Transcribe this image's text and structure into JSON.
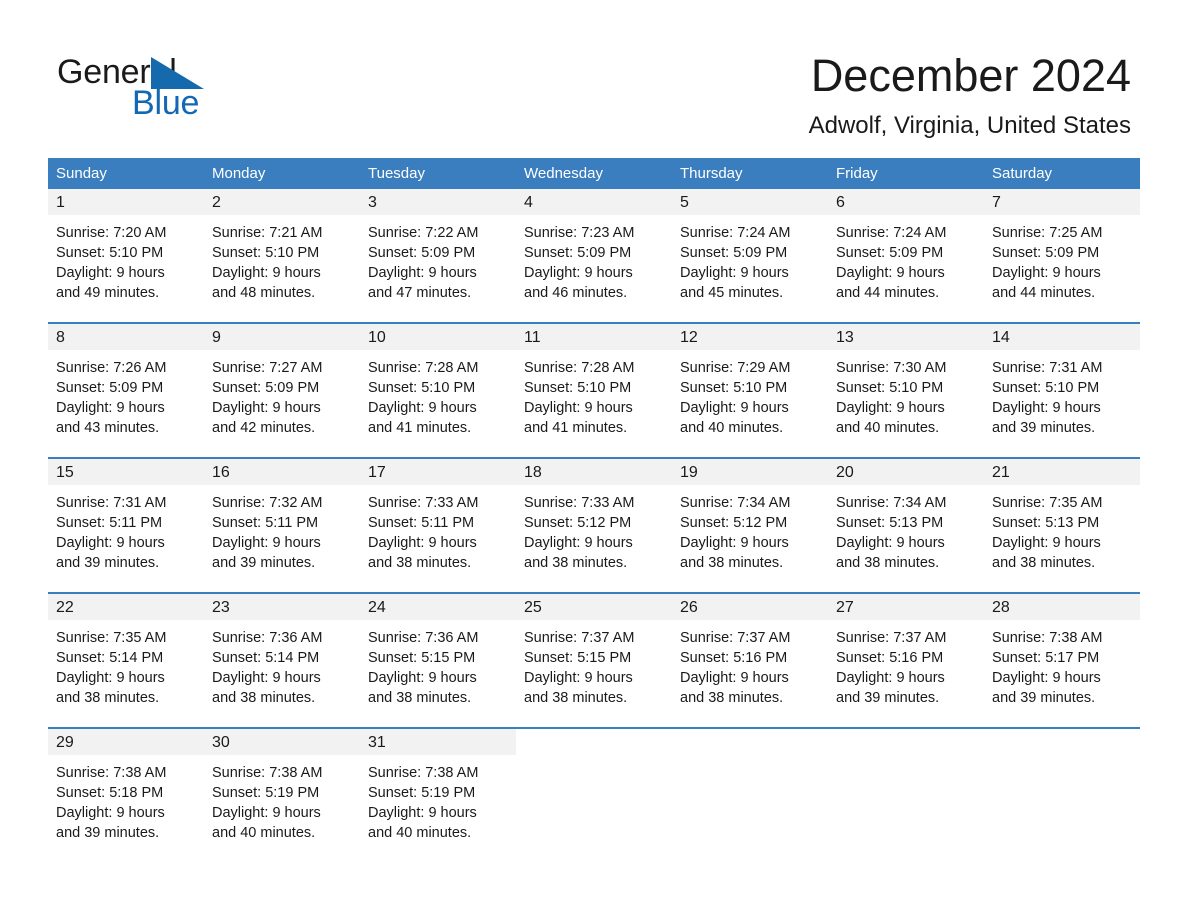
{
  "brand": {
    "name_part1": "General",
    "name_part2": "Blue",
    "accent_color": "#1268b3",
    "triangle_color": "#156aae"
  },
  "header": {
    "month_title": "December 2024",
    "location": "Adwolf, Virginia, United States"
  },
  "theme": {
    "header_row_color": "#3a7ebf",
    "daynum_band_color": "#f2f2f2",
    "text_color": "#1a1a1a"
  },
  "weekdays": [
    "Sunday",
    "Monday",
    "Tuesday",
    "Wednesday",
    "Thursday",
    "Friday",
    "Saturday"
  ],
  "weeks": [
    [
      {
        "day": "1",
        "sunrise": "Sunrise: 7:20 AM",
        "sunset": "Sunset: 5:10 PM",
        "daylight1": "Daylight: 9 hours",
        "daylight2": "and 49 minutes."
      },
      {
        "day": "2",
        "sunrise": "Sunrise: 7:21 AM",
        "sunset": "Sunset: 5:10 PM",
        "daylight1": "Daylight: 9 hours",
        "daylight2": "and 48 minutes."
      },
      {
        "day": "3",
        "sunrise": "Sunrise: 7:22 AM",
        "sunset": "Sunset: 5:09 PM",
        "daylight1": "Daylight: 9 hours",
        "daylight2": "and 47 minutes."
      },
      {
        "day": "4",
        "sunrise": "Sunrise: 7:23 AM",
        "sunset": "Sunset: 5:09 PM",
        "daylight1": "Daylight: 9 hours",
        "daylight2": "and 46 minutes."
      },
      {
        "day": "5",
        "sunrise": "Sunrise: 7:24 AM",
        "sunset": "Sunset: 5:09 PM",
        "daylight1": "Daylight: 9 hours",
        "daylight2": "and 45 minutes."
      },
      {
        "day": "6",
        "sunrise": "Sunrise: 7:24 AM",
        "sunset": "Sunset: 5:09 PM",
        "daylight1": "Daylight: 9 hours",
        "daylight2": "and 44 minutes."
      },
      {
        "day": "7",
        "sunrise": "Sunrise: 7:25 AM",
        "sunset": "Sunset: 5:09 PM",
        "daylight1": "Daylight: 9 hours",
        "daylight2": "and 44 minutes."
      }
    ],
    [
      {
        "day": "8",
        "sunrise": "Sunrise: 7:26 AM",
        "sunset": "Sunset: 5:09 PM",
        "daylight1": "Daylight: 9 hours",
        "daylight2": "and 43 minutes."
      },
      {
        "day": "9",
        "sunrise": "Sunrise: 7:27 AM",
        "sunset": "Sunset: 5:09 PM",
        "daylight1": "Daylight: 9 hours",
        "daylight2": "and 42 minutes."
      },
      {
        "day": "10",
        "sunrise": "Sunrise: 7:28 AM",
        "sunset": "Sunset: 5:10 PM",
        "daylight1": "Daylight: 9 hours",
        "daylight2": "and 41 minutes."
      },
      {
        "day": "11",
        "sunrise": "Sunrise: 7:28 AM",
        "sunset": "Sunset: 5:10 PM",
        "daylight1": "Daylight: 9 hours",
        "daylight2": "and 41 minutes."
      },
      {
        "day": "12",
        "sunrise": "Sunrise: 7:29 AM",
        "sunset": "Sunset: 5:10 PM",
        "daylight1": "Daylight: 9 hours",
        "daylight2": "and 40 minutes."
      },
      {
        "day": "13",
        "sunrise": "Sunrise: 7:30 AM",
        "sunset": "Sunset: 5:10 PM",
        "daylight1": "Daylight: 9 hours",
        "daylight2": "and 40 minutes."
      },
      {
        "day": "14",
        "sunrise": "Sunrise: 7:31 AM",
        "sunset": "Sunset: 5:10 PM",
        "daylight1": "Daylight: 9 hours",
        "daylight2": "and 39 minutes."
      }
    ],
    [
      {
        "day": "15",
        "sunrise": "Sunrise: 7:31 AM",
        "sunset": "Sunset: 5:11 PM",
        "daylight1": "Daylight: 9 hours",
        "daylight2": "and 39 minutes."
      },
      {
        "day": "16",
        "sunrise": "Sunrise: 7:32 AM",
        "sunset": "Sunset: 5:11 PM",
        "daylight1": "Daylight: 9 hours",
        "daylight2": "and 39 minutes."
      },
      {
        "day": "17",
        "sunrise": "Sunrise: 7:33 AM",
        "sunset": "Sunset: 5:11 PM",
        "daylight1": "Daylight: 9 hours",
        "daylight2": "and 38 minutes."
      },
      {
        "day": "18",
        "sunrise": "Sunrise: 7:33 AM",
        "sunset": "Sunset: 5:12 PM",
        "daylight1": "Daylight: 9 hours",
        "daylight2": "and 38 minutes."
      },
      {
        "day": "19",
        "sunrise": "Sunrise: 7:34 AM",
        "sunset": "Sunset: 5:12 PM",
        "daylight1": "Daylight: 9 hours",
        "daylight2": "and 38 minutes."
      },
      {
        "day": "20",
        "sunrise": "Sunrise: 7:34 AM",
        "sunset": "Sunset: 5:13 PM",
        "daylight1": "Daylight: 9 hours",
        "daylight2": "and 38 minutes."
      },
      {
        "day": "21",
        "sunrise": "Sunrise: 7:35 AM",
        "sunset": "Sunset: 5:13 PM",
        "daylight1": "Daylight: 9 hours",
        "daylight2": "and 38 minutes."
      }
    ],
    [
      {
        "day": "22",
        "sunrise": "Sunrise: 7:35 AM",
        "sunset": "Sunset: 5:14 PM",
        "daylight1": "Daylight: 9 hours",
        "daylight2": "and 38 minutes."
      },
      {
        "day": "23",
        "sunrise": "Sunrise: 7:36 AM",
        "sunset": "Sunset: 5:14 PM",
        "daylight1": "Daylight: 9 hours",
        "daylight2": "and 38 minutes."
      },
      {
        "day": "24",
        "sunrise": "Sunrise: 7:36 AM",
        "sunset": "Sunset: 5:15 PM",
        "daylight1": "Daylight: 9 hours",
        "daylight2": "and 38 minutes."
      },
      {
        "day": "25",
        "sunrise": "Sunrise: 7:37 AM",
        "sunset": "Sunset: 5:15 PM",
        "daylight1": "Daylight: 9 hours",
        "daylight2": "and 38 minutes."
      },
      {
        "day": "26",
        "sunrise": "Sunrise: 7:37 AM",
        "sunset": "Sunset: 5:16 PM",
        "daylight1": "Daylight: 9 hours",
        "daylight2": "and 38 minutes."
      },
      {
        "day": "27",
        "sunrise": "Sunrise: 7:37 AM",
        "sunset": "Sunset: 5:16 PM",
        "daylight1": "Daylight: 9 hours",
        "daylight2": "and 39 minutes."
      },
      {
        "day": "28",
        "sunrise": "Sunrise: 7:38 AM",
        "sunset": "Sunset: 5:17 PM",
        "daylight1": "Daylight: 9 hours",
        "daylight2": "and 39 minutes."
      }
    ],
    [
      {
        "day": "29",
        "sunrise": "Sunrise: 7:38 AM",
        "sunset": "Sunset: 5:18 PM",
        "daylight1": "Daylight: 9 hours",
        "daylight2": "and 39 minutes."
      },
      {
        "day": "30",
        "sunrise": "Sunrise: 7:38 AM",
        "sunset": "Sunset: 5:19 PM",
        "daylight1": "Daylight: 9 hours",
        "daylight2": "and 40 minutes."
      },
      {
        "day": "31",
        "sunrise": "Sunrise: 7:38 AM",
        "sunset": "Sunset: 5:19 PM",
        "daylight1": "Daylight: 9 hours",
        "daylight2": "and 40 minutes."
      },
      {
        "day": "",
        "sunrise": "",
        "sunset": "",
        "daylight1": "",
        "daylight2": ""
      },
      {
        "day": "",
        "sunrise": "",
        "sunset": "",
        "daylight1": "",
        "daylight2": ""
      },
      {
        "day": "",
        "sunrise": "",
        "sunset": "",
        "daylight1": "",
        "daylight2": ""
      },
      {
        "day": "",
        "sunrise": "",
        "sunset": "",
        "daylight1": "",
        "daylight2": ""
      }
    ]
  ]
}
